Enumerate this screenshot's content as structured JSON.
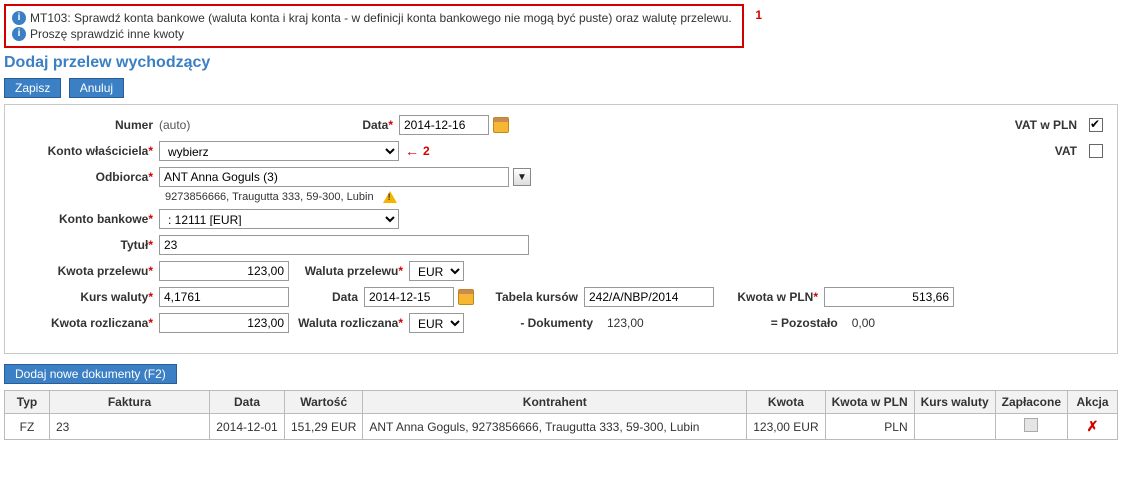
{
  "notices": {
    "line1": "MT103: Sprawdź konta bankowe (waluta konta i kraj konta - w definicji konta bankowego nie mogą być puste) oraz walutę przelewu.",
    "line2": "Proszę sprawdzić inne kwoty",
    "marker": "1"
  },
  "page_title": "Dodaj przelew wychodzący",
  "toolbar": {
    "save": "Zapisz",
    "cancel": "Anuluj"
  },
  "form": {
    "number_label": "Numer",
    "number_value": "(auto)",
    "date_label": "Data",
    "date_value": "2014-12-16",
    "vat_pln_label": "VAT w PLN",
    "vat_pln_checked": true,
    "owner_account_label": "Konto właściciela",
    "owner_account_value": "wybierz",
    "vat_label": "VAT",
    "marker2": "2",
    "recipient_label": "Odbiorca",
    "recipient_value": "ANT Anna Goguls (3)",
    "recipient_detail": "9273856666, Traugutta 333, 59-300, Lubin",
    "bank_account_label": "Konto bankowe",
    "bank_account_value": ": 12111 [EUR]",
    "title_label": "Tytuł",
    "title_value": "23",
    "transfer_amount_label": "Kwota przelewu",
    "transfer_amount_value": "123,00",
    "transfer_currency_label": "Waluta przelewu",
    "transfer_currency_value": "EUR",
    "rate_label": "Kurs waluty",
    "rate_value": "4,1761",
    "date2_label": "Data",
    "date2_value": "2014-12-15",
    "rate_table_label": "Tabela kursów",
    "rate_table_value": "242/A/NBP/2014",
    "amount_pln_label": "Kwota w PLN",
    "amount_pln_value": "513,66",
    "settled_amount_label": "Kwota rozliczana",
    "settled_amount_value": "123,00",
    "settled_currency_label": "Waluta rozliczana",
    "settled_currency_value": "EUR",
    "documents_label": "- Dokumenty",
    "documents_value": "123,00",
    "remaining_label": "= Pozostało",
    "remaining_value": "0,00"
  },
  "add_docs_button": "Dodaj nowe dokumenty (F2)",
  "table": {
    "headers": {
      "type": "Typ",
      "invoice": "Faktura",
      "date": "Data",
      "value": "Wartość",
      "contractor": "Kontrahent",
      "amount": "Kwota",
      "amount_pln": "Kwota w PLN",
      "rate": "Kurs waluty",
      "paid": "Zapłacone",
      "action": "Akcja"
    },
    "row": {
      "type": "FZ",
      "invoice": "23",
      "date": "2014-12-01",
      "value": "151,29 EUR",
      "contractor": "ANT Anna Goguls, 9273856666, Traugutta 333, 59-300, Lubin",
      "amount": "123,00 EUR",
      "amount_pln": "PLN"
    }
  }
}
